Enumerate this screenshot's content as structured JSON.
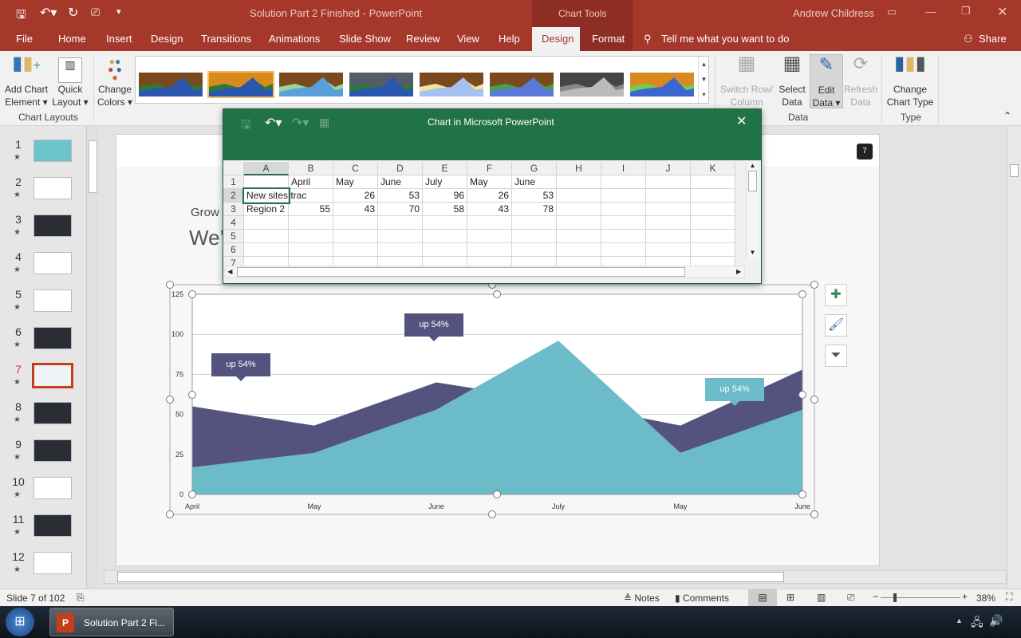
{
  "titlebar": {
    "title": "Solution Part 2 Finished  -  PowerPoint",
    "context": "Chart Tools",
    "user": "Andrew Childress"
  },
  "tabs": [
    "File",
    "Home",
    "Insert",
    "Design",
    "Transitions",
    "Animations",
    "Slide Show",
    "Review",
    "View",
    "Help",
    "Design",
    "Format"
  ],
  "tell_me": "Tell me what you want to do",
  "share": "Share",
  "ribbon": {
    "add_chart": "Add Chart",
    "add_chart2": "Element",
    "quick": "Quick",
    "quick2": "Layout",
    "group_layouts": "Chart Layouts",
    "change_colors": "Change",
    "change_colors2": "Colors",
    "switch": "Switch Row/",
    "switch2": "Column",
    "select": "Select",
    "select2": "Data",
    "edit": "Edit",
    "edit2": "Data",
    "refresh": "Refresh",
    "refresh2": "Data",
    "group_data": "Data",
    "change_type": "Change",
    "change_type2": "Chart Type",
    "group_type": "Type"
  },
  "slides": [
    "1",
    "2",
    "3",
    "4",
    "5",
    "6",
    "7",
    "8",
    "9",
    "10",
    "11",
    "12"
  ],
  "active_slide": "7",
  "slide": {
    "subtitle": "Grow",
    "title": "We’",
    "badge": "7"
  },
  "excel": {
    "title": "Chart in Microsoft PowerPoint",
    "columns": [
      "A",
      "B",
      "C",
      "D",
      "E",
      "F",
      "G",
      "H",
      "I",
      "J",
      "K"
    ],
    "rows": [
      [
        "",
        "April",
        "May",
        "June",
        "July",
        "May",
        "June"
      ],
      [
        "New sites trac",
        "",
        "26",
        "53",
        "96",
        "26",
        "53"
      ],
      [
        "Region 2",
        "55",
        "43",
        "70",
        "58",
        "43",
        "78"
      ]
    ],
    "row_numbers": [
      "1",
      "2",
      "3",
      "4",
      "5",
      "6",
      "7"
    ]
  },
  "chart_data": {
    "type": "area",
    "categories": [
      "April",
      "May",
      "June",
      "July",
      "May",
      "June"
    ],
    "series": [
      {
        "name": "Region 2",
        "values": [
          55,
          43,
          70,
          58,
          43,
          78
        ],
        "color": "#54537f"
      },
      {
        "name": "New sites trac",
        "values": [
          17,
          26,
          53,
          96,
          26,
          53
        ],
        "color": "#6bbcc8"
      }
    ],
    "yticks": [
      "0",
      "25",
      "50",
      "75",
      "100",
      "125"
    ],
    "ylim": [
      0,
      125
    ],
    "annotations": [
      {
        "text": "up 54%"
      },
      {
        "text": "up 54%"
      },
      {
        "text": "up 54%"
      }
    ]
  },
  "status": {
    "slide_info": "Slide 7 of 102",
    "notes": "Notes",
    "comments": "Comments",
    "zoom": "38%"
  },
  "taskbar": {
    "app": "Solution Part 2 Fi..."
  }
}
